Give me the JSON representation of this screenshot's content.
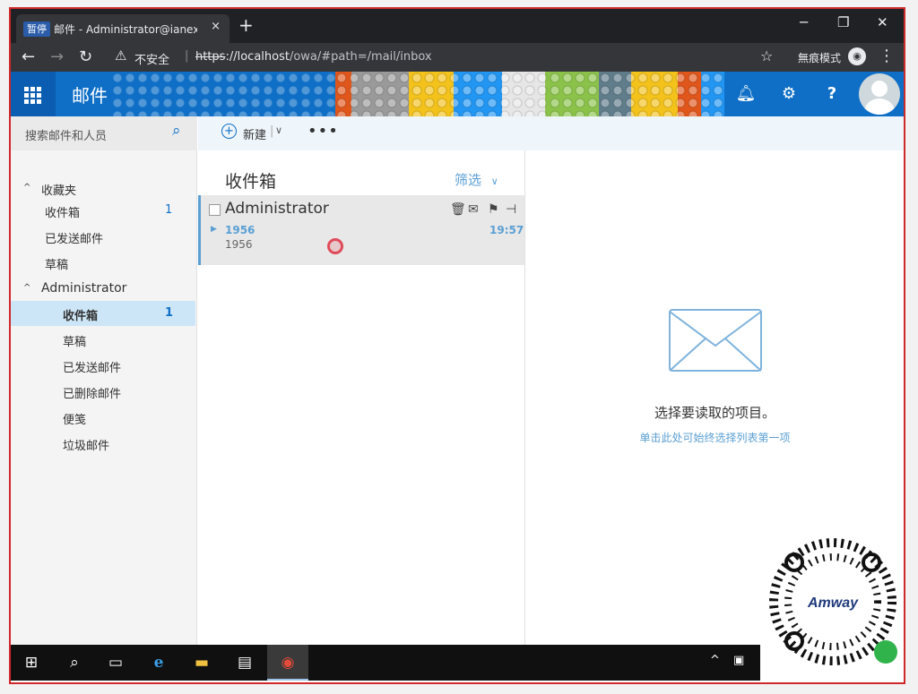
{
  "browser": {
    "favicon_text": "暂停",
    "tab_title": "邮件 - Administrator@ianext.co",
    "tab_close": "×",
    "new_tab": "+",
    "min": "─",
    "max": "❐",
    "close": "✕",
    "insecure_label": "不安全",
    "url_scheme": "https",
    "url_host": "://localhost",
    "url_path": "/owa/#path=/mail/inbox",
    "incognito_label": "無痕模式"
  },
  "header": {
    "app_name": "邮件"
  },
  "left_pane": {
    "search_placeholder": "搜索邮件和人员",
    "favorites_label": "收藏夹",
    "favorites": [
      {
        "label": "收件箱",
        "count": "1"
      },
      {
        "label": "已发送邮件",
        "count": ""
      },
      {
        "label": "草稿",
        "count": ""
      }
    ],
    "account_label": "Administrator",
    "folders": [
      {
        "label": "收件箱",
        "count": "1"
      },
      {
        "label": "草稿",
        "count": ""
      },
      {
        "label": "已发送邮件",
        "count": ""
      },
      {
        "label": "已删除邮件",
        "count": ""
      },
      {
        "label": "便笺",
        "count": ""
      },
      {
        "label": "垃圾邮件",
        "count": ""
      }
    ]
  },
  "toolbar": {
    "new_label": "新建"
  },
  "message_list": {
    "title": "收件箱",
    "filter_label": "筛选",
    "messages": [
      {
        "sender": "Administrator",
        "subject": "1956",
        "preview": "1956",
        "time": "19:57"
      }
    ]
  },
  "reading_pane": {
    "empty_message": "选择要读取的项目。",
    "link_text": "单击此处可始终选择列表第一项"
  },
  "colors": {
    "accent": "#0f6fc6",
    "link": "#5a9fd4",
    "selected": "#cde6f7"
  }
}
